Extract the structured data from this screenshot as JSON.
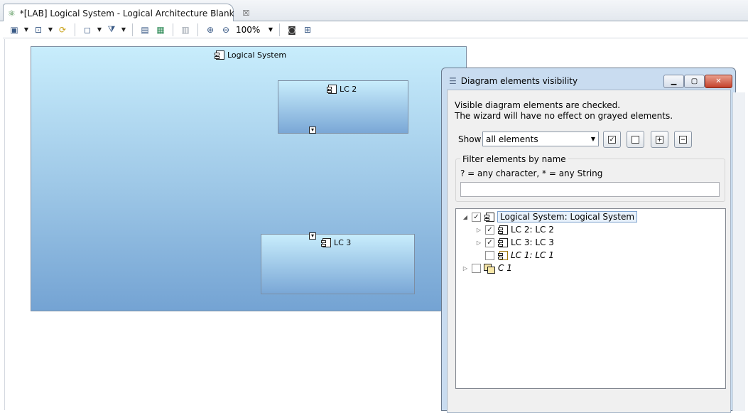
{
  "editor_tab": {
    "title": "*[LAB] Logical System - Logical Architecture Blank",
    "close": "☒"
  },
  "toolbar": {
    "zoom": "100%"
  },
  "diagram": {
    "logical_system": "Logical System",
    "lc2": "LC 2",
    "lc3": "LC 3",
    "port_mark": "▾"
  },
  "dialog": {
    "title": "Diagram elements visibility",
    "message_line1": "Visible diagram elements are checked.",
    "message_line2": "The wizard will have no effect on grayed elements.",
    "show_label": "Show",
    "show_value": "all elements",
    "filter_title": "Filter elements by name",
    "filter_hint": "? = any character, * = any String",
    "filter_value": "",
    "tree": [
      {
        "label": "Logical System: Logical System",
        "checked": true,
        "selected": true
      },
      {
        "label": "LC 2: LC 2",
        "checked": true
      },
      {
        "label": "LC 3: LC 3",
        "checked": true
      },
      {
        "label": "LC 1: LC 1",
        "checked": false,
        "italic": true
      },
      {
        "label": "C 1",
        "checked": false,
        "italic": true
      }
    ]
  },
  "colors": {
    "diagram_top": "#c8edfc",
    "diagram_bottom": "#74a3d3",
    "dialog_frame": "#c9dcf0"
  }
}
